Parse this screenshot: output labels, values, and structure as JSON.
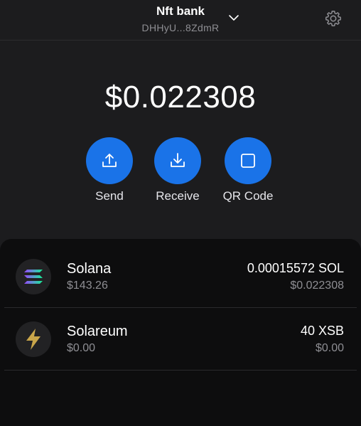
{
  "header": {
    "wallet_name": "Nft bank",
    "wallet_address": "DHHyU...8ZdmR",
    "dropdown_icon": "chevron-down-icon",
    "settings_icon": "gear-icon"
  },
  "balance": "$0.022308",
  "actions": [
    {
      "label": "Send",
      "icon": "upload-icon"
    },
    {
      "label": "Receive",
      "icon": "download-icon"
    },
    {
      "label": "QR Code",
      "icon": "qr-code-icon"
    }
  ],
  "assets": [
    {
      "name": "Solana",
      "price": "$143.26",
      "amount": "0.00015572 SOL",
      "value": "$0.022308",
      "icon": "solana-logo-icon"
    },
    {
      "name": "Solareum",
      "price": "$0.00",
      "amount": "40 XSB",
      "value": "$0.00",
      "icon": "lightning-icon"
    }
  ],
  "colors": {
    "background": "#1c1c1e",
    "panel": "#0d0d0e",
    "accent": "#1a73e8",
    "muted_text": "#8e8e93",
    "lightning": "#c9a64a"
  }
}
